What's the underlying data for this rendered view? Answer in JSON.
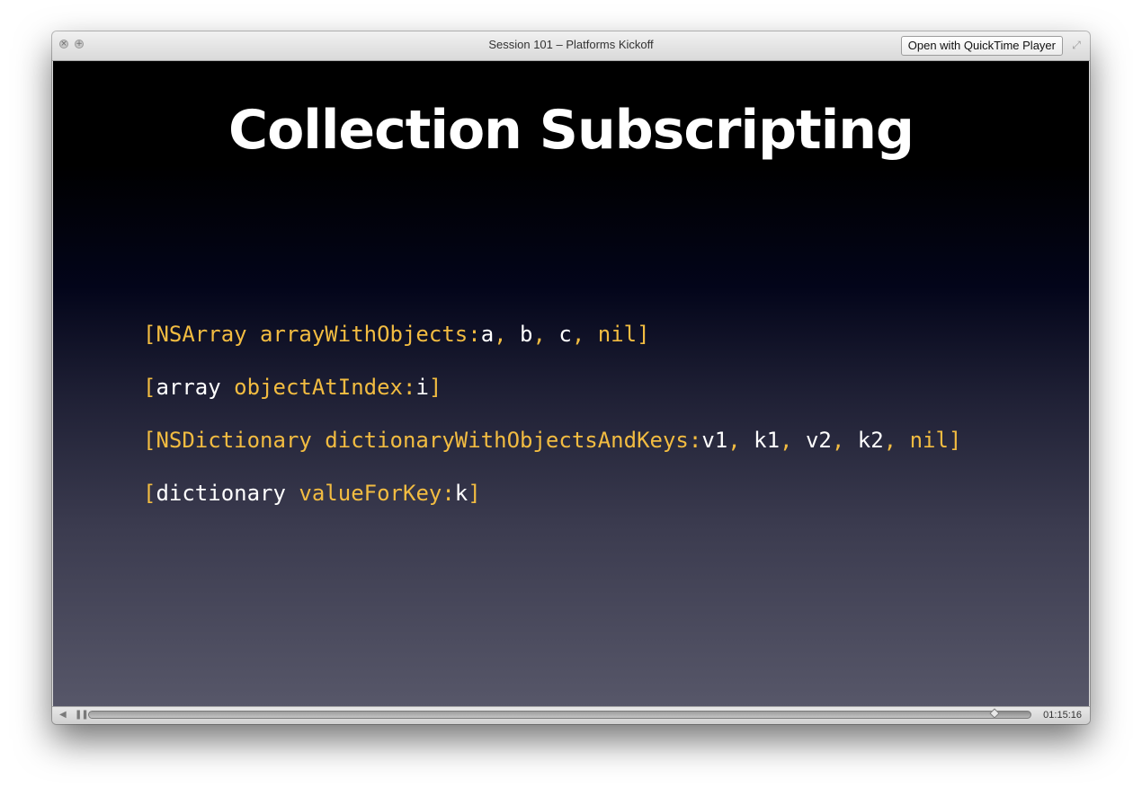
{
  "window": {
    "title": "Session 101 – Platforms Kickoff",
    "open_button_label": "Open with QuickTime Player",
    "close_glyph": "×",
    "zoom_glyph": "+",
    "fullscreen_glyph": "⤢"
  },
  "slide": {
    "title": "Collection Subscripting",
    "lines": [
      [
        {
          "t": "[NSArray arrayWithObjects:",
          "c": "y"
        },
        {
          "t": "a",
          "c": "w"
        },
        {
          "t": ", ",
          "c": "y"
        },
        {
          "t": "b",
          "c": "w"
        },
        {
          "t": ", ",
          "c": "y"
        },
        {
          "t": "c",
          "c": "w"
        },
        {
          "t": ", nil]",
          "c": "y"
        }
      ],
      [
        {
          "t": "[",
          "c": "y"
        },
        {
          "t": "array",
          "c": "w"
        },
        {
          "t": " objectAtIndex:",
          "c": "y"
        },
        {
          "t": "i",
          "c": "w"
        },
        {
          "t": "]",
          "c": "y"
        }
      ],
      [
        {
          "t": "[NSDictionary dictionaryWithObjectsAndKeys:",
          "c": "y"
        },
        {
          "t": "v1",
          "c": "w"
        },
        {
          "t": ", ",
          "c": "y"
        },
        {
          "t": "k1",
          "c": "w"
        },
        {
          "t": ", ",
          "c": "y"
        },
        {
          "t": "v2",
          "c": "w"
        },
        {
          "t": ", ",
          "c": "y"
        },
        {
          "t": "k2",
          "c": "w"
        },
        {
          "t": ", nil]",
          "c": "y"
        }
      ],
      [
        {
          "t": "[",
          "c": "y"
        },
        {
          "t": "dictionary",
          "c": "w"
        },
        {
          "t": " valueForKey:",
          "c": "y"
        },
        {
          "t": "k",
          "c": "w"
        },
        {
          "t": "]",
          "c": "y"
        }
      ]
    ]
  },
  "controls": {
    "time": "01:15:16",
    "progress": 0.962,
    "volume_icon": "speaker-icon",
    "pause_icon": "pause-icon",
    "volume_glyph": "◀",
    "pause_glyph": "❚❚"
  },
  "colors": {
    "code_keyword": "#f2bc41",
    "code_value": "#ffffff"
  }
}
